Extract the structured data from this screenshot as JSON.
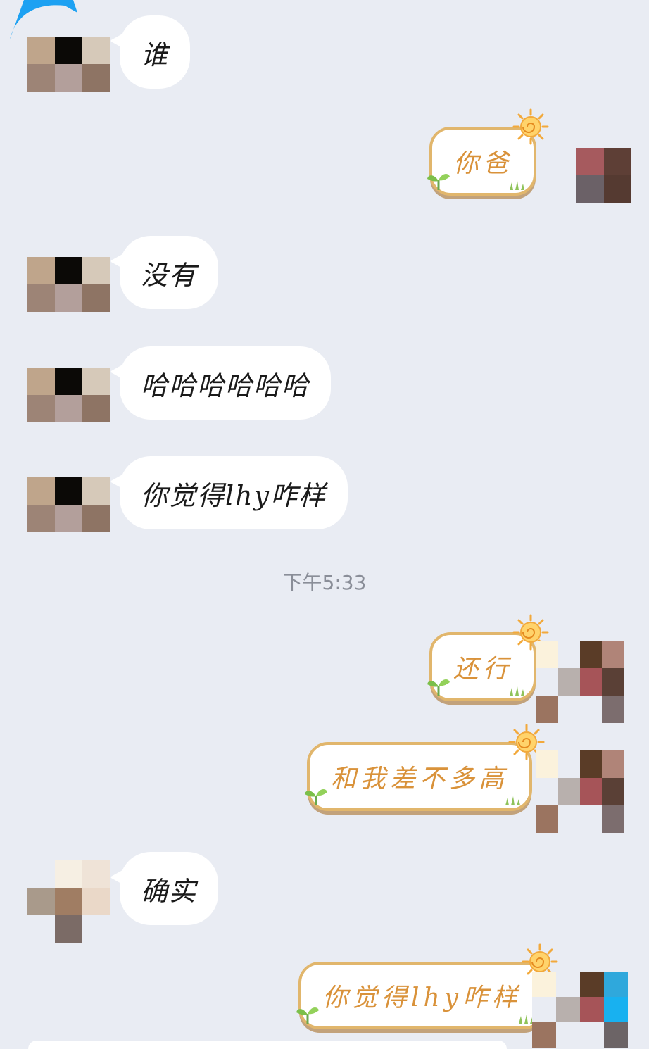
{
  "messages": [
    {
      "side": "in",
      "text": "谁"
    },
    {
      "side": "out",
      "text": "你爸"
    },
    {
      "side": "in",
      "text": "没有"
    },
    {
      "side": "in",
      "text": "哈哈哈哈哈哈"
    },
    {
      "side": "in",
      "text": "你觉得lhy咋样"
    },
    {
      "side": "out",
      "text": "还行"
    },
    {
      "side": "out",
      "text": "和我差不多高"
    },
    {
      "side": "in",
      "text": "确实"
    },
    {
      "side": "out",
      "text": "你觉得lhy咋样"
    }
  ],
  "timestamp": "下午5:33",
  "colors": {
    "background": "#e9ecf3",
    "bubble_incoming": "#ffffff",
    "bubble_outgoing_border": "#e1b66c",
    "bubble_outgoing_text": "#d9923a",
    "timestamp_text": "#8a8e98"
  },
  "icons": {
    "outgoing_bubble_decor": [
      "sun-icon",
      "sprout-icon",
      "grass-icon"
    ],
    "avatars": "pixelated-avatar"
  }
}
